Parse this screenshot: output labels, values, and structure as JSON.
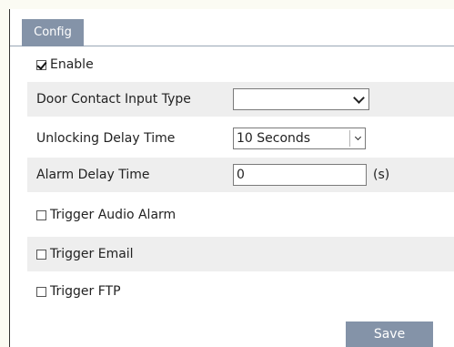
{
  "tabs": [
    {
      "label": "Config",
      "active": true
    }
  ],
  "form": {
    "enable": {
      "label": "Enable",
      "checked": true
    },
    "door_contact_input_type": {
      "label": "Door Contact Input Type",
      "value": ""
    },
    "unlocking_delay_time": {
      "label": "Unlocking Delay Time",
      "value": "10 Seconds"
    },
    "alarm_delay_time": {
      "label": "Alarm Delay Time",
      "value": "0",
      "unit": "(s)"
    },
    "trigger_audio_alarm": {
      "label": "Trigger Audio Alarm",
      "checked": false
    },
    "trigger_email": {
      "label": "Trigger Email",
      "checked": false
    },
    "trigger_ftp": {
      "label": "Trigger FTP",
      "checked": false
    }
  },
  "actions": {
    "save_label": "Save"
  },
  "colors": {
    "accent": "#8493a8",
    "row_shade": "#eeeeee",
    "page_background": "#fbfbf3"
  },
  "icons": {
    "checkbox_checked": "check-icon",
    "select_arrow": "chevron-down-icon"
  }
}
